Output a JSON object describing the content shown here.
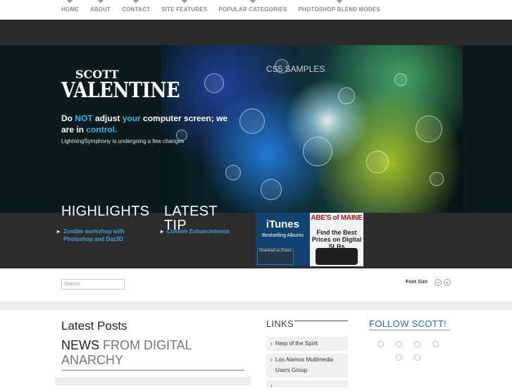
{
  "nav": {
    "items": [
      {
        "label": "HOME"
      },
      {
        "label": "ABOUT"
      },
      {
        "label": "CONTACT"
      },
      {
        "label": "SITE FEATURES"
      },
      {
        "label": "POPULAR CATEGORIES"
      },
      {
        "label": "PHOTOSHOP BLEND MODES"
      }
    ]
  },
  "logo": {
    "line1": "SCOTT",
    "line2": "VALENTINE"
  },
  "hero": {
    "tag_do": "Do ",
    "tag_not": "NOT",
    "tag_adjust": " adjust ",
    "tag_your": "your",
    "tag_rest": " computer screen; we are in ",
    "tag_control": "control.",
    "sub": "LightningSymphony is undergoing a few changes",
    "cs5": "CS5 SAMPLES"
  },
  "highlights": {
    "title": "HIGHLIGHTS",
    "link": "Zombie workshop with Photoshop and Daz3D"
  },
  "latest_tip": {
    "title": "LATEST TIP",
    "link": "Custom Enhancements"
  },
  "ads": {
    "itunes_title": "iTunes",
    "itunes_sub": "Bestselling Albums",
    "itunes_btn": "Download on iTunes",
    "abes_title": "ABE'S of MAINE",
    "abes_sub": "Find the Best Prices on Digital SLRs"
  },
  "search": {
    "placeholder": "Search"
  },
  "font_size": {
    "label": "Font Size",
    "minus": "−",
    "plus": "+"
  },
  "posts": {
    "heading": "Latest Posts",
    "news_a": "NEWS ",
    "news_b": "FROM DIGITAL ANARCHY"
  },
  "links": {
    "heading": "LINKS",
    "items": [
      {
        "label": "Harp of the Spirit"
      },
      {
        "label": "Los Alamos Multimedia Users Group"
      }
    ]
  },
  "follow": {
    "heading": "FOLLOW SCOTT!"
  }
}
